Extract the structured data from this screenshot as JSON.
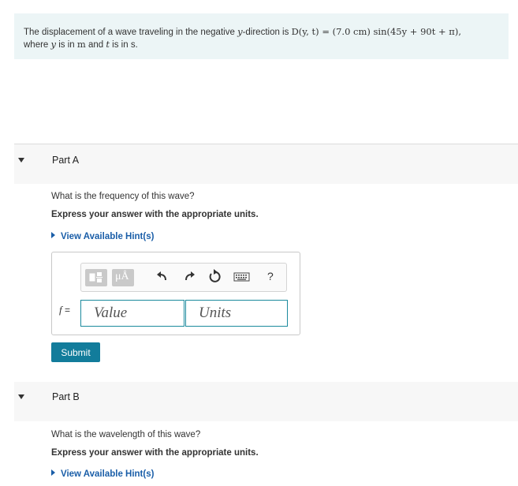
{
  "problem": {
    "text_1": "The displacement of a wave traveling in the negative ",
    "var_y": "y",
    "text_2": "-direction is ",
    "equation": "D(y, t) = (7.0 cm) sin(45y + 90t + π),",
    "text_3": "where ",
    "var_y2": "y",
    "text_4": " is in ",
    "unit_m": "m",
    "text_5": " and ",
    "var_t": "t",
    "text_6": " is in s."
  },
  "part_a": {
    "title": "Part A",
    "question": "What is the frequency of this wave?",
    "instruction": "Express your answer with the appropriate units.",
    "hint_link": "View Available Hint(s)",
    "answer_label": "f",
    "answer_eq": " =",
    "value_placeholder": "Value",
    "units_placeholder": "Units",
    "submit_label": "Submit"
  },
  "toolbar": {
    "unit_symbol": "μÅ",
    "help": "?"
  },
  "part_b": {
    "title": "Part B",
    "question": "What is the wavelength of this wave?",
    "instruction": "Express your answer with the appropriate units.",
    "hint_link": "View Available Hint(s)"
  },
  "colors": {
    "accent": "#127c9b",
    "field_border": "#1b8a9d",
    "link": "#1a5ea8",
    "problem_bg": "#ecf5f6"
  }
}
